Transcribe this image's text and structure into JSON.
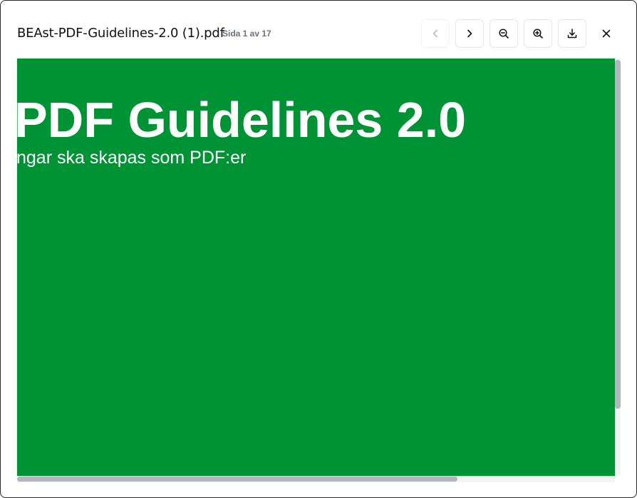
{
  "dialog": {
    "file_name": "BEAst-PDF-Guidelines-2.0 (1).pdf",
    "page_indicator": "Sida 1 av 17"
  },
  "toolbar": {
    "prev_page": {
      "icon": "chevron-left-icon",
      "enabled": false
    },
    "next_page": {
      "icon": "chevron-right-icon",
      "enabled": true
    },
    "zoom_out": {
      "icon": "zoom-out-icon"
    },
    "zoom_in": {
      "icon": "zoom-in-icon"
    },
    "download": {
      "icon": "download-icon"
    },
    "close": {
      "icon": "close-icon"
    }
  },
  "document": {
    "title_text": "PDF Guidelines 2.0",
    "subtitle_text": "ngar ska skapas som PDF:er",
    "page_color": "#009336",
    "text_color": "#ffffff"
  }
}
